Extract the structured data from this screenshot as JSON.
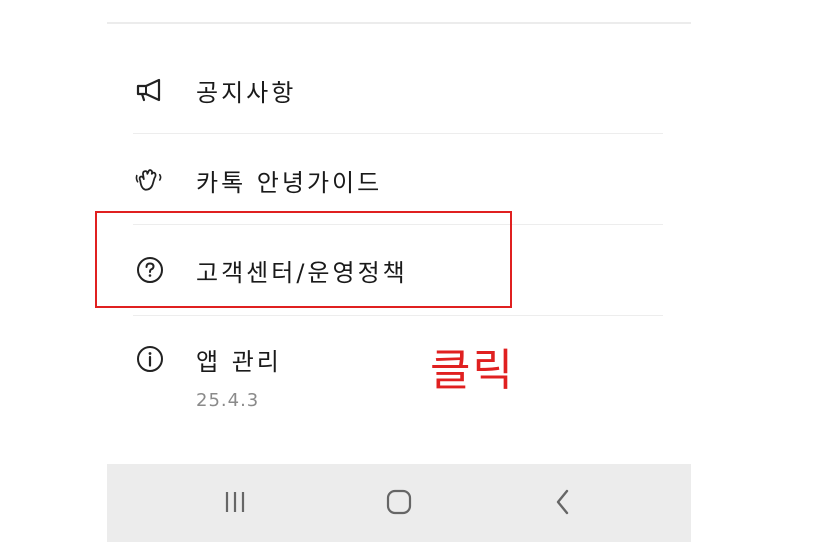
{
  "menu": {
    "items": [
      {
        "label": "공지사항",
        "icon": "megaphone-icon"
      },
      {
        "label": "카톡 안녕가이드",
        "icon": "waving-hand-icon"
      },
      {
        "label": "고객센터/운영정책",
        "icon": "question-circle-icon"
      },
      {
        "label": "앱 관리",
        "icon": "info-circle-icon",
        "sublabel": "25.4.3"
      }
    ]
  },
  "annotation": {
    "click_text": "클릭",
    "color": "#e02020"
  },
  "navbar": {
    "buttons": [
      "recent-apps-icon",
      "home-icon",
      "back-icon"
    ]
  }
}
